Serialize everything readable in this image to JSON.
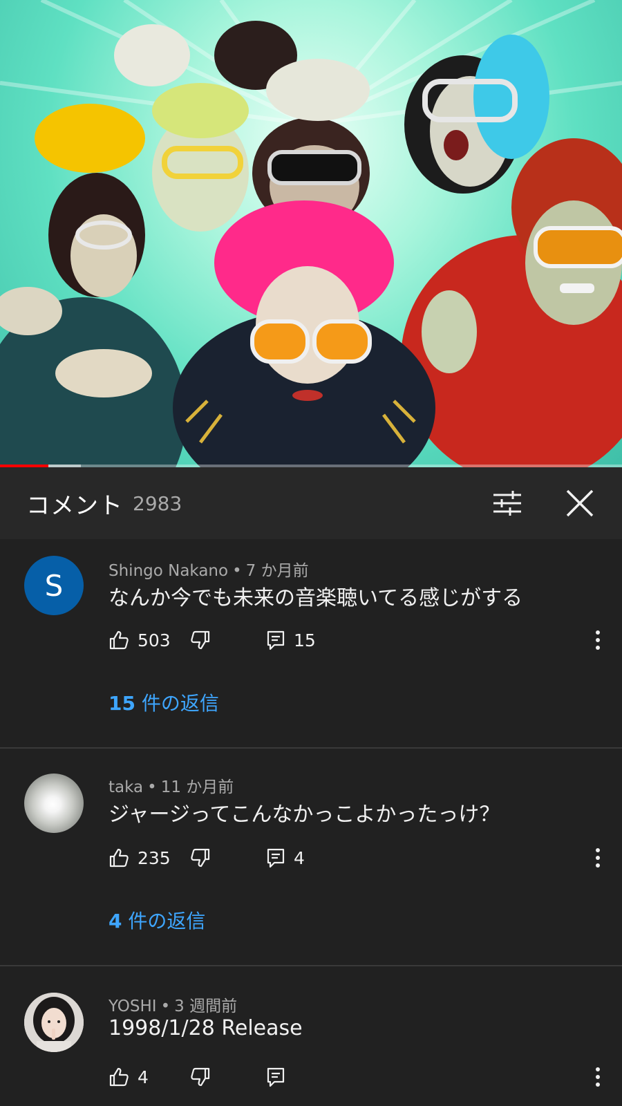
{
  "player": {
    "progress_played": 0.078,
    "progress_buffered": 0.13
  },
  "comments_panel": {
    "title": "コメント",
    "count": "2983",
    "sort_icon": "tune-icon",
    "close_icon": "close-icon"
  },
  "comments": [
    {
      "author": "Shingo Nakano",
      "time": "7 か月前",
      "text": "なんか今でも未来の音楽聴いてる感じがする",
      "likes": "503",
      "reply_count": "15",
      "replies_count": "15",
      "replies_suffix": " 件の返信",
      "avatar_letter": "S"
    },
    {
      "author": "taka",
      "time": "11 か月前",
      "text": "ジャージってこんなかっこよかったっけ？",
      "likes": "235",
      "reply_count": "4",
      "replies_count": "4",
      "replies_suffix": " 件の返信"
    },
    {
      "author": "YOSHI",
      "time": "3 週間前",
      "text": "1998/1/28 Release",
      "likes": "4",
      "reply_count": ""
    }
  ],
  "colors": {
    "background": "#212121",
    "header_bg": "#282828",
    "link": "#3ea6ff",
    "progress": "#ff0000",
    "avatar_s": "#065fa8"
  },
  "dot": "•"
}
